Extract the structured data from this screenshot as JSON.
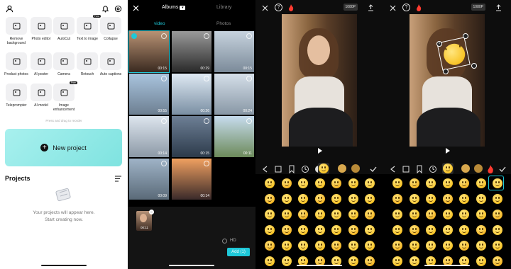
{
  "home": {
    "tools": [
      {
        "label": "Remove background",
        "icon": "eraser-icon"
      },
      {
        "label": "Photo editor",
        "icon": "image-icon"
      },
      {
        "label": "AutoCut",
        "icon": "autocut-icon"
      },
      {
        "label": "Text to image",
        "icon": "text-image-icon",
        "badge": "Free"
      },
      {
        "label": "Collapse",
        "icon": "chevron-up-icon"
      },
      {
        "label": "Product photos",
        "icon": "product-icon"
      },
      {
        "label": "AI poster",
        "icon": "poster-icon"
      },
      {
        "label": "Camera",
        "icon": "camera-icon"
      },
      {
        "label": "Retouch",
        "icon": "retouch-icon"
      },
      {
        "label": "Auto captions",
        "icon": "captions-icon"
      },
      {
        "label": "Teleprompter",
        "icon": "teleprompter-icon"
      },
      {
        "label": "AI model",
        "icon": "ai-model-icon"
      },
      {
        "label": "Image enhancement",
        "icon": "enhance-icon",
        "badge": "Free"
      }
    ],
    "hint": "Press and drag to reorder",
    "new_project": "New project",
    "projects_title": "Projects",
    "empty_line1": "Your projects will appear here.",
    "empty_line2": "Start creating now."
  },
  "picker": {
    "albums_label": "Albums",
    "library_label": "Library",
    "tab_video": "video",
    "tab_photos": "Photos",
    "durations": [
      "00:15",
      "00:29",
      "00:15",
      "00:55",
      "00:26",
      "00:24",
      "00:14",
      "00:15",
      "00:11",
      "00:09",
      "00:14"
    ],
    "selected_duration": "00:11",
    "hd_label": "HD",
    "add_button": "Add (1)"
  },
  "editor": {
    "resolution": "1080P"
  },
  "colors": {
    "accent": "#1ec8d8",
    "new_project_bg": "#86e6e2",
    "fire": "#ff3b30"
  }
}
